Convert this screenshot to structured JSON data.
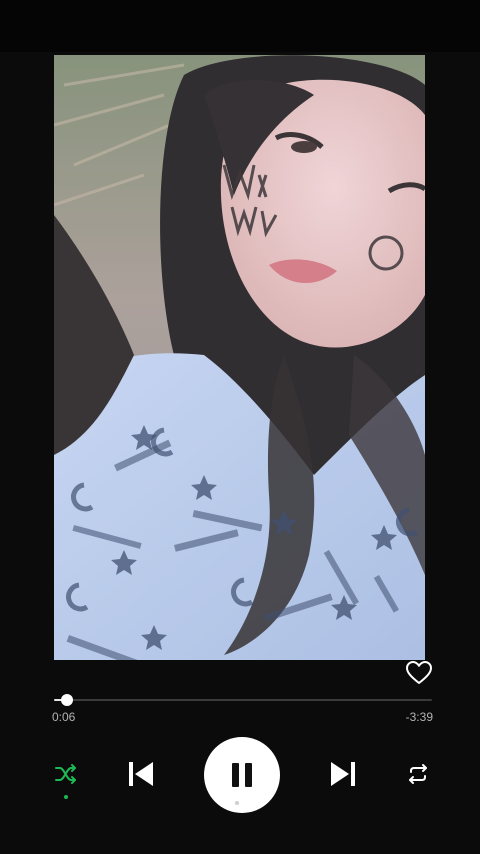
{
  "player": {
    "progress_fraction": 0.035,
    "time_elapsed": "0:06",
    "time_remaining": "-3:39"
  },
  "icons": {
    "like": "heart-outline-icon",
    "shuffle": "shuffle-icon",
    "previous": "skip-previous-icon",
    "play_pause": "pause-icon",
    "next": "skip-next-icon",
    "repeat": "repeat-icon"
  },
  "colors": {
    "background": "#0b0b0b",
    "accent_green": "#1db954",
    "icon_white": "#ffffff",
    "muted_text": "#b3b3b3",
    "track": "#3a3a3a"
  },
  "states": {
    "shuffle_active": true,
    "liked": false,
    "playing": true
  }
}
